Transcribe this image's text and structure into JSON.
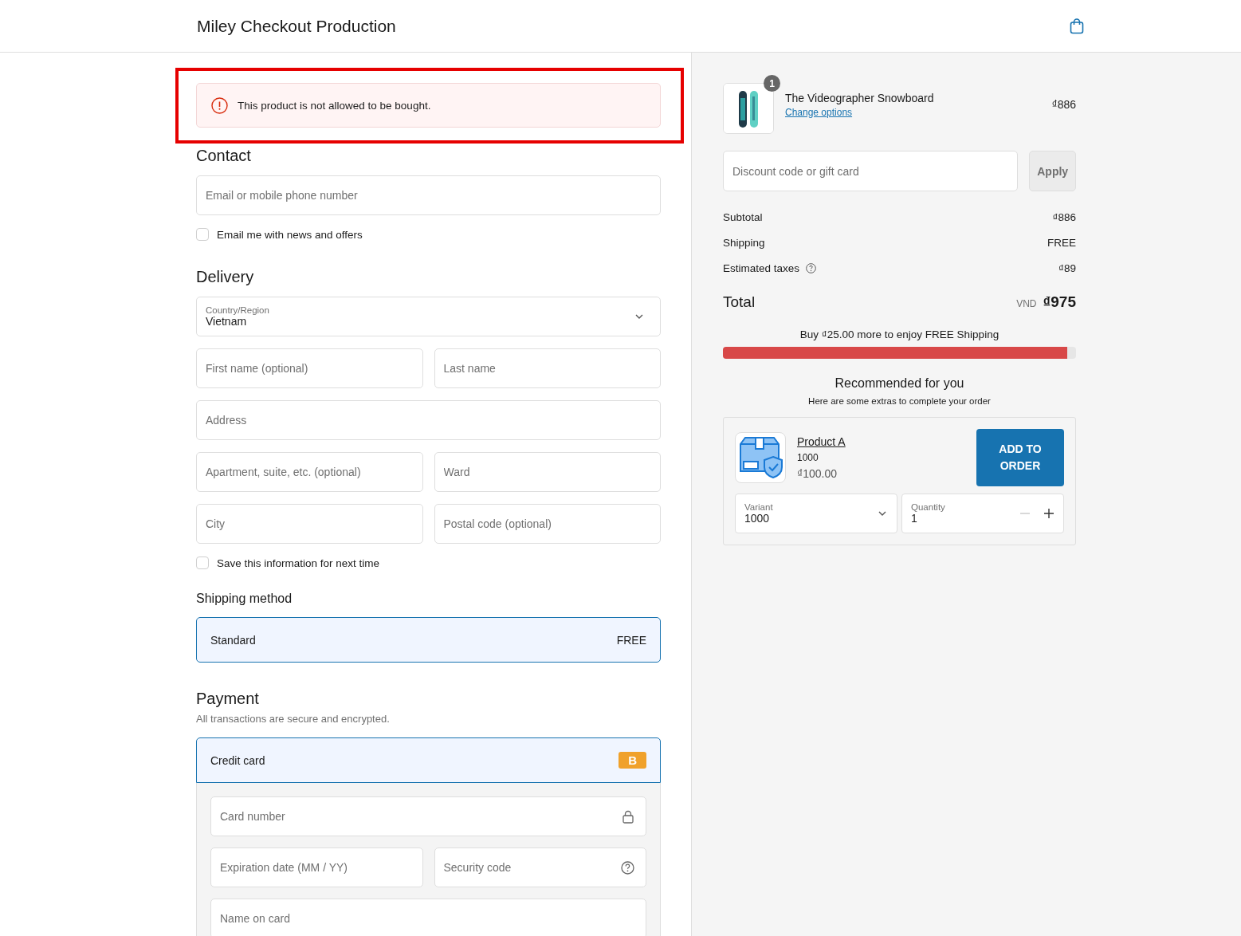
{
  "header": {
    "title": "Miley Checkout Production"
  },
  "error": {
    "message": "This product is not allowed to be bought.",
    "highlighted": true
  },
  "contact": {
    "title": "Contact",
    "email": {
      "placeholder": "Email or mobile phone number"
    },
    "newsletter": {
      "label": "Email me with news and offers",
      "checked": false
    }
  },
  "delivery": {
    "title": "Delivery",
    "country": {
      "label": "Country/Region",
      "value": "Vietnam"
    },
    "rows": [
      [
        {
          "placeholder": "First name (optional)"
        },
        {
          "placeholder": "Last name"
        }
      ],
      [
        {
          "placeholder": "Address"
        }
      ],
      [
        {
          "placeholder": "Apartment, suite, etc. (optional)"
        },
        {
          "placeholder": "Ward"
        }
      ],
      [
        {
          "placeholder": "City"
        },
        {
          "placeholder": "Postal code (optional)"
        }
      ]
    ],
    "save_info": {
      "label": "Save this information for next time",
      "checked": false
    }
  },
  "shipping": {
    "title": "Shipping method",
    "options": [
      {
        "label": "Standard",
        "price": "FREE",
        "selected": true
      }
    ]
  },
  "payment": {
    "title": "Payment",
    "subtitle": "All transactions are secure and encrypted.",
    "methods": [
      {
        "label": "Credit card",
        "badge": "B",
        "selected": true
      }
    ],
    "card_fields": [
      [
        {
          "placeholder": "Card number",
          "kind": "lock"
        }
      ],
      [
        {
          "placeholder": "Expiration date (MM / YY)",
          "kind": "plain"
        },
        {
          "placeholder": "Security code",
          "kind": "help"
        }
      ],
      [
        {
          "placeholder": "Name on card",
          "kind": "plain"
        }
      ]
    ]
  },
  "summary": {
    "item": {
      "quantity": "1",
      "name": "The Videographer Snowboard",
      "link": "Change options",
      "price": "₫886"
    },
    "discount": {
      "placeholder": "Discount code or gift card",
      "button": "Apply"
    },
    "rows": [
      {
        "label": "Subtotal",
        "value": "₫886",
        "kind": "plain"
      },
      {
        "label": "Shipping",
        "value": "FREE",
        "kind": "plain"
      },
      {
        "label": "Estimated taxes",
        "value": "₫89",
        "kind": "info"
      }
    ],
    "total": {
      "label": "Total",
      "currency": "VND",
      "value": "₫975"
    },
    "free_shipping": {
      "message": "Buy ₫25.00 more to enjoy FREE Shipping",
      "level": 0.975
    },
    "recommended": {
      "title": "Recommended for you",
      "subtitle": "Here are some extras to complete your order",
      "product": {
        "name": "Product A",
        "variant": "1000",
        "price": "₫100.00",
        "button": "ADD TO ORDER",
        "variant_field": {
          "label": "Variant",
          "value": "1000"
        },
        "quantity_field": {
          "label": "Quantity",
          "value": "1"
        }
      }
    }
  }
}
